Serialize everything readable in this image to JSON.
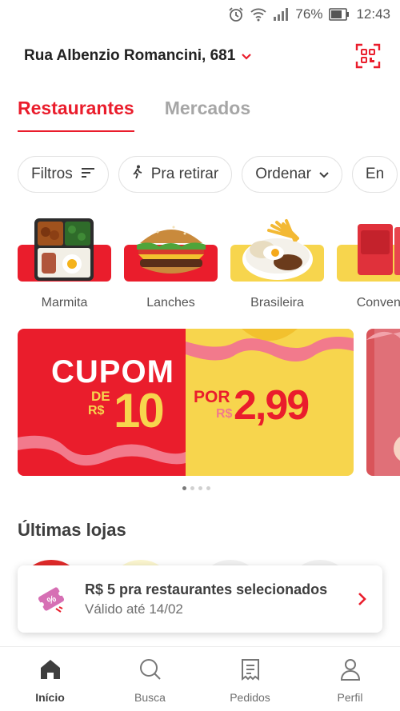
{
  "status_bar": {
    "battery": "76%",
    "time": "12:43",
    "icons": [
      "alarm-icon",
      "wifi-icon",
      "signal-icon",
      "battery-icon"
    ]
  },
  "header": {
    "address": "Rua Albenzio Romancini, 681",
    "qr_icon": "qr-code-icon"
  },
  "tabs": [
    {
      "label": "Restaurantes",
      "active": true
    },
    {
      "label": "Mercados",
      "active": false
    }
  ],
  "filters": [
    {
      "label": "Filtros",
      "icon": "filter-lines-icon"
    },
    {
      "label": "Pra retirar",
      "icon": "walking-person-icon"
    },
    {
      "label": "Ordenar",
      "icon": "chevron-down-icon"
    },
    {
      "label": "En",
      "icon": ""
    }
  ],
  "categories": [
    {
      "label": "Marmita",
      "bg": "#ea1d2c"
    },
    {
      "label": "Lanches",
      "bg": "#ea1d2c"
    },
    {
      "label": "Brasileira",
      "bg": "#f7d54d"
    },
    {
      "label": "Conveniê",
      "bg": "#f7d54d"
    }
  ],
  "banner": {
    "left_big": "CUPOM",
    "left_de": "DE",
    "left_currency": "R$",
    "left_value": "10",
    "right_por": "POR",
    "right_currency": "R$",
    "right_value": "2,99",
    "dots": 4,
    "active_dot": 0
  },
  "section": {
    "title": "Últimas lojas"
  },
  "toast": {
    "title": "R$ 5 pra restaurantes selecionados",
    "subtitle": "Válido até 14/02",
    "badge": "%"
  },
  "nav": [
    {
      "label": "Início",
      "icon": "home-icon",
      "active": true
    },
    {
      "label": "Busca",
      "icon": "search-icon",
      "active": false
    },
    {
      "label": "Pedidos",
      "icon": "orders-icon",
      "active": false
    },
    {
      "label": "Perfil",
      "icon": "profile-icon",
      "active": false
    }
  ],
  "colors": {
    "brand": "#ea1d2c",
    "yellow": "#f7d54d",
    "pink": "#f27a8c"
  }
}
